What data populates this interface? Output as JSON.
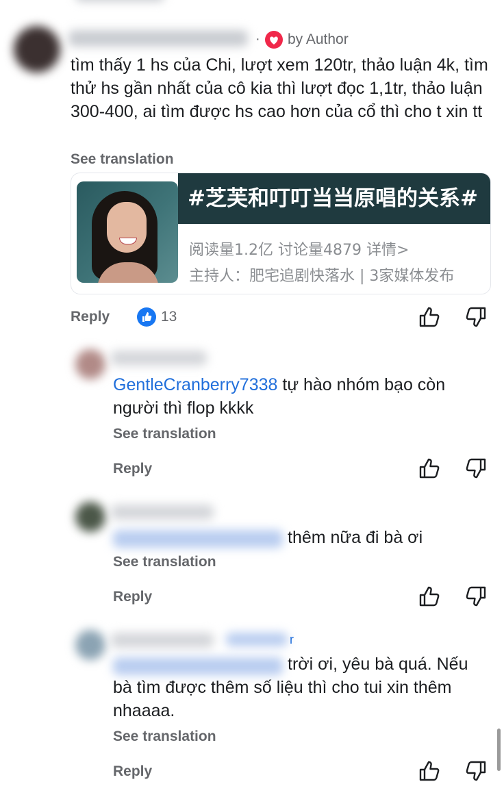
{
  "top_comment": {
    "author_badge": "by Author",
    "separator": "·",
    "text": "tìm thấy 1 hs của Chi, lượt xem 120tr, thảo luận 4k, tìm thử hs gần nhất của cô kia thì lượt đọc 1,1tr, thảo luận 300-400, ai tìm được hs cao hơn của cổ thì cho t xin tt",
    "see_translation": "See translation",
    "card": {
      "title": "#芝芙和叮叮当当原唱的关系#",
      "stats": "阅读量1.2亿  讨论量4879  详情>",
      "host": "主持人：肥宅追剧快落水 | 3家媒体发布"
    },
    "reply_label": "Reply",
    "like_count": "13"
  },
  "replies": [
    {
      "mention": "GentleCranberry7338",
      "text": " tự hào nhóm bạo còn người thì flop kkkk",
      "see_translation": "See translation",
      "reply_label": "Reply"
    },
    {
      "text": "thêm nữa đi bà ơi",
      "see_translation": "See translation",
      "reply_label": "Reply"
    },
    {
      "badge_tail": "r",
      "text_line1": "trời ơi, yêu bà quá. Nếu",
      "text_rest": "bà tìm được thêm số liệu thì cho tui xin thêm nhaaaa.",
      "see_translation": "See translation",
      "reply_label": "Reply"
    }
  ],
  "colors": {
    "link": "#216fdb",
    "like_badge": "#1877f2",
    "heart": "#f0284a",
    "muted": "#65676b"
  }
}
